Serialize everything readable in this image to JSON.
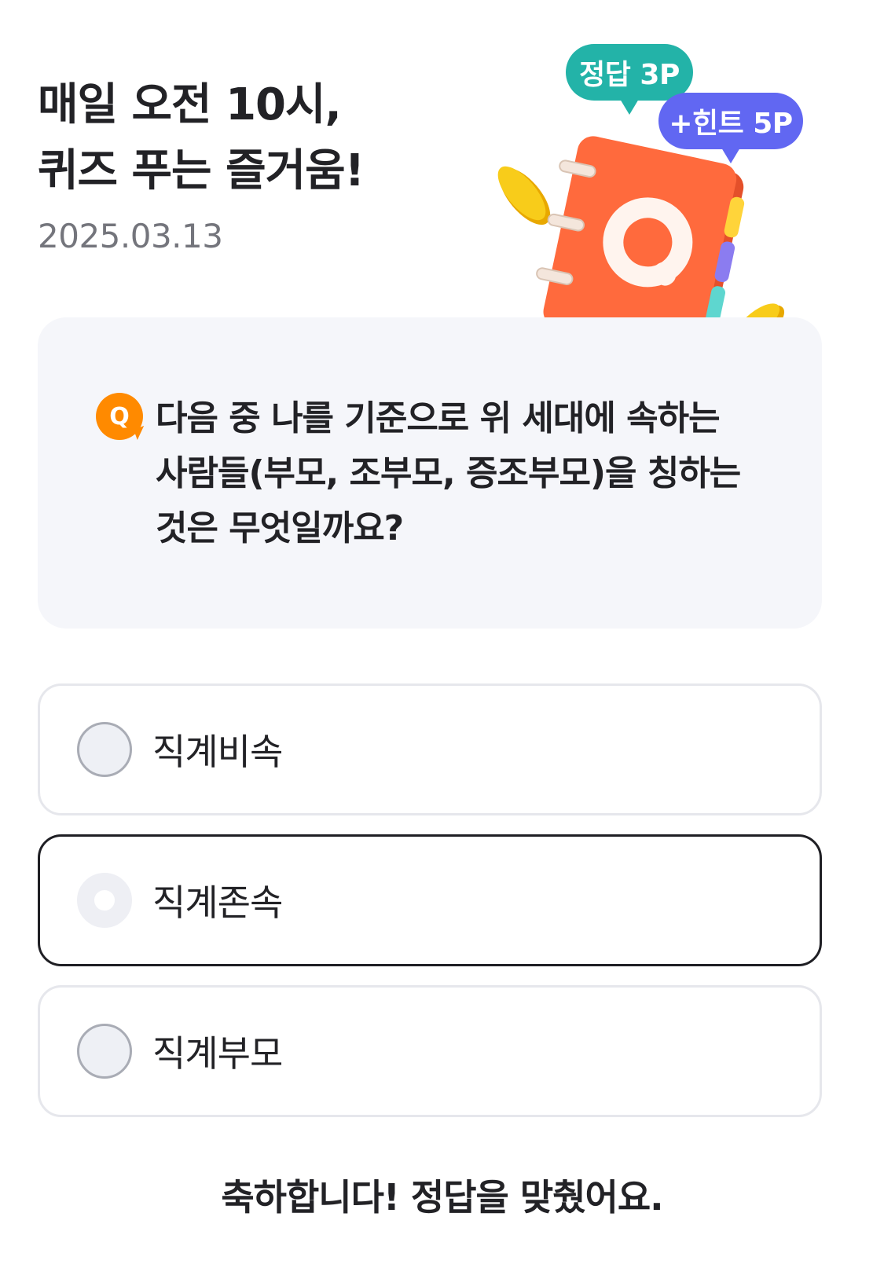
{
  "header": {
    "title_line1": "매일 오전 10시,",
    "title_line2": "퀴즈 푸는 즐거움!",
    "date": "2025.03.13"
  },
  "reward": {
    "answer_badge": "정답 3P",
    "hint_badge": "+힌트 5P"
  },
  "illustration": {
    "icon": "quiz-notebook-icon",
    "letter": "Q"
  },
  "question": {
    "badge": "Q",
    "lines": [
      "다음 중 나를 기준으로 위 세대에 속하는",
      "사람들(부모, 조부모, 증조부모)을 칭하는",
      "것은 무엇일까요?"
    ]
  },
  "options": [
    {
      "label": "직계비속",
      "selected": false
    },
    {
      "label": "직계존속",
      "selected": true
    },
    {
      "label": "직계부모",
      "selected": false
    }
  ],
  "result_message": "축하합니다! 정답을 맞췄어요.",
  "colors": {
    "answer_badge": "#23b3a8",
    "hint_badge": "#6167f2",
    "q_badge": "#ff8a00",
    "notebook": "#ff6a3d",
    "coin": "#f5c400",
    "card_bg": "#f5f6fa"
  }
}
